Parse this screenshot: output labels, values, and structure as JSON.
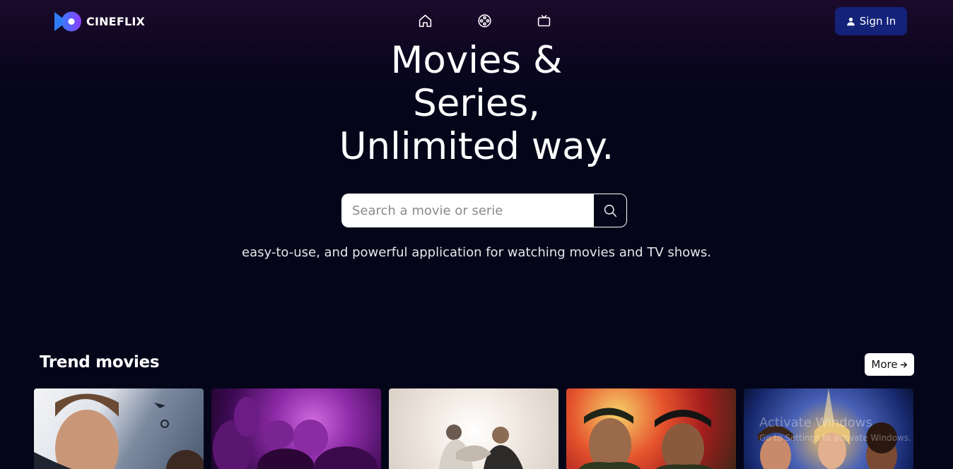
{
  "app": {
    "name": "CINEFLIX",
    "brand_colors": {
      "accent_gradient": [
        "#3b7bff",
        "#8b3dff"
      ],
      "background": "#05051a",
      "signin_bg": "#14227a"
    }
  },
  "header": {
    "nav": [
      {
        "icon": "home-icon"
      },
      {
        "icon": "film-reel-icon"
      },
      {
        "icon": "tv-icon"
      }
    ],
    "signin_label": "Sign In",
    "signin_icon": "user-icon"
  },
  "hero": {
    "title_line1": "Movies &",
    "title_line2": "Series,",
    "title_line3": "Unlimited way.",
    "search_placeholder": "Search a movie or serie",
    "search_icon": "search-icon",
    "tagline": "easy-to-use, and powerful application for watching movies and TV shows."
  },
  "trend": {
    "title": "Trend movies",
    "more_label": "More",
    "more_icon": "arrow-right-icon",
    "posters": [
      {
        "icon": "poster-image"
      },
      {
        "icon": "poster-image"
      },
      {
        "icon": "poster-image"
      },
      {
        "icon": "poster-image"
      },
      {
        "icon": "poster-image"
      }
    ]
  },
  "os_overlay": {
    "title": "Activate Windows",
    "subtitle": "Go to Settings to activate Windows."
  }
}
